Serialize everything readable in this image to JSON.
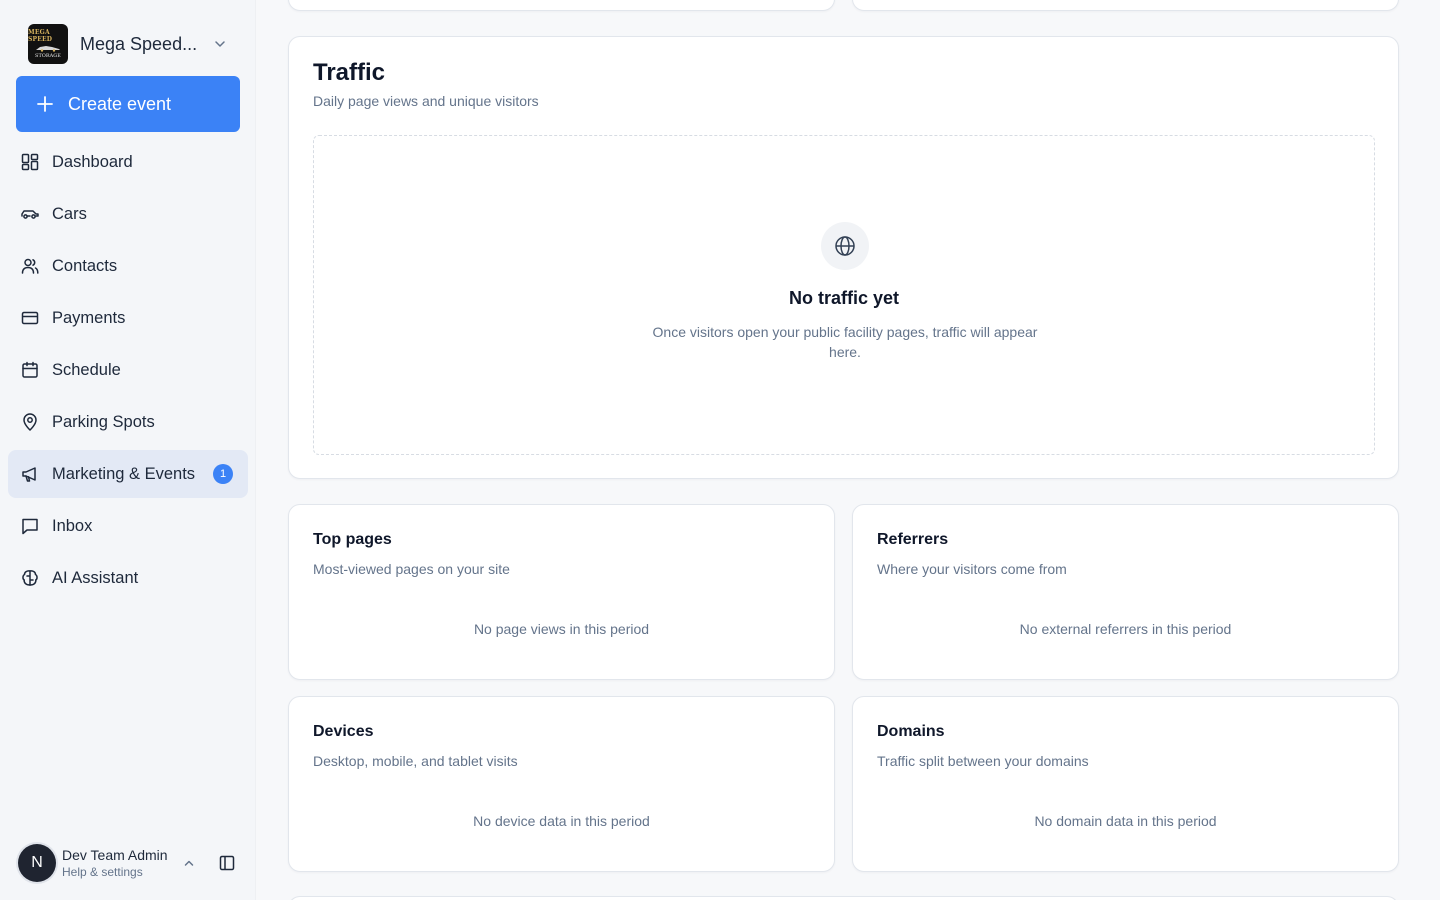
{
  "org": {
    "name": "Mega Speed...",
    "logo_text_top": "MEGA SPEED",
    "logo_text_bottom": "STORAGE"
  },
  "create_event": {
    "label": "Create event"
  },
  "nav": [
    {
      "label": "Dashboard",
      "icon": "dashboard-icon"
    },
    {
      "label": "Cars",
      "icon": "car-icon"
    },
    {
      "label": "Contacts",
      "icon": "users-icon"
    },
    {
      "label": "Payments",
      "icon": "credit-card-icon"
    },
    {
      "label": "Schedule",
      "icon": "calendar-icon"
    },
    {
      "label": "Parking Spots",
      "icon": "map-pin-icon"
    },
    {
      "label": "Marketing & Events",
      "icon": "megaphone-icon",
      "badge": "1",
      "active": true
    },
    {
      "label": "Inbox",
      "icon": "message-icon"
    },
    {
      "label": "AI Assistant",
      "icon": "brain-icon"
    }
  ],
  "user": {
    "initial": "N",
    "name": "Dev Team Admin",
    "subtitle": "Help & settings"
  },
  "traffic": {
    "title": "Traffic",
    "subtitle": "Daily page views and unique visitors",
    "empty_title": "No traffic yet",
    "empty_desc": "Once visitors open your public facility pages, traffic will appear here."
  },
  "cards": {
    "top_pages": {
      "title": "Top pages",
      "subtitle": "Most-viewed pages on your site",
      "empty": "No page views in this period"
    },
    "referrers": {
      "title": "Referrers",
      "subtitle": "Where your visitors come from",
      "empty": "No external referrers in this period"
    },
    "devices": {
      "title": "Devices",
      "subtitle": "Desktop, mobile, and tablet visits",
      "empty": "No device data in this period"
    },
    "domains": {
      "title": "Domains",
      "subtitle": "Traffic split between your domains",
      "empty": "No domain data in this period"
    }
  },
  "colors": {
    "accent": "#3b82f6",
    "sidebar_bg": "#f4f6f9",
    "active_bg": "#e3e9f5",
    "muted_text": "#64748b"
  }
}
